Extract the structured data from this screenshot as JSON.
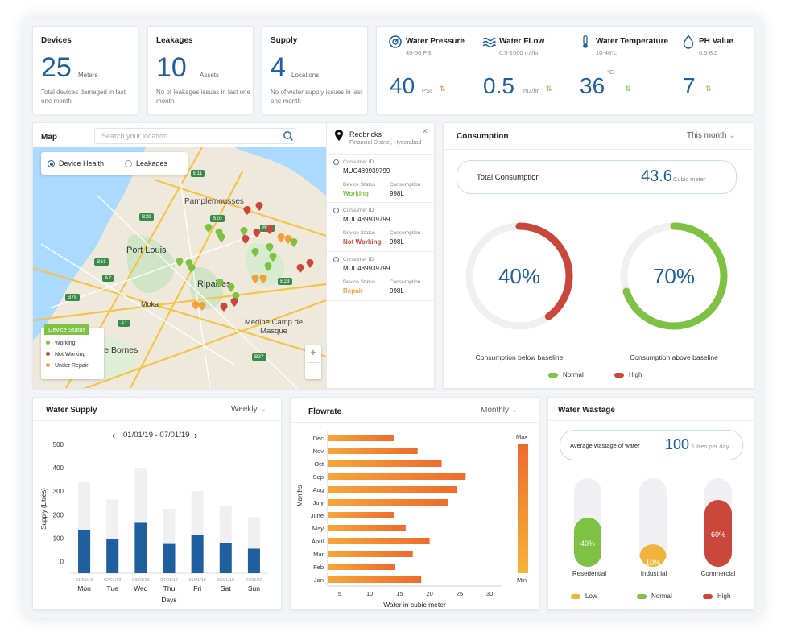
{
  "stats": [
    {
      "title": "Devices",
      "value": "25",
      "unit": "Meters",
      "desc": "Total devices damaged in last one month"
    },
    {
      "title": "Leakages",
      "value": "10",
      "unit": "Assets",
      "desc": "No of leakages issues in last one month"
    },
    {
      "title": "Supply",
      "value": "4",
      "unit": "Locations",
      "desc": "No of water supply issues in last one month"
    }
  ],
  "kpis": [
    {
      "title": "Water Pressure",
      "range": "45-50 PSI",
      "value": "40",
      "unit": "PSI",
      "icon": "gauge-icon"
    },
    {
      "title": "Water FLow",
      "range": "0.5-1000 m³/hr",
      "value": "0.5",
      "unit": "m3/hr",
      "icon": "waves-icon"
    },
    {
      "title": "Water Temperature",
      "range": "10-40°c",
      "value": "36",
      "unit": "°C",
      "icon": "thermometer-icon"
    },
    {
      "title": "PH Value",
      "range": "6.5-8.5",
      "value": "7",
      "unit": "",
      "icon": "droplet-icon"
    }
  ],
  "map": {
    "title": "Map",
    "search_placeholder": "Search your location",
    "toggle": {
      "device_health": "Device Health",
      "leakages": "Leakages"
    },
    "places": [
      "Pamplemousses",
      "Port Louis",
      "Ripailles",
      "Moka",
      "Medine Camp de Masque",
      "Quatre Bornes"
    ],
    "road_labels": [
      "B11",
      "B29",
      "B20",
      "B21",
      "B31",
      "A2",
      "B23",
      "B78",
      "A1",
      "B27"
    ],
    "legend": {
      "title": "Device Status",
      "working": "Working",
      "not_working": "Not Working",
      "under_repair": "Under Repair"
    },
    "zoom_in": "+",
    "zoom_out": "−"
  },
  "location": {
    "name": "Redbricks",
    "sub": "Financial District, Hyderabad"
  },
  "consumers": [
    {
      "id_label": "Consumer ID",
      "id": "MUC489939799",
      "status_label": "Device Status",
      "status": "Working",
      "cons_label": "Consumption",
      "cons": "998L"
    },
    {
      "id_label": "Consumer ID",
      "id": "MUC489939799",
      "status_label": "Device Status",
      "status": "Not Working",
      "cons_label": "Consumption",
      "cons": "998L"
    },
    {
      "id_label": "Consumer ID",
      "id": "MUC489939799",
      "status_label": "Device Status",
      "status": "Repair",
      "cons_label": "Consumption",
      "cons": "998L"
    }
  ],
  "consumption": {
    "title": "Consumption",
    "period": "This month",
    "total_label": "Total Consumption",
    "total_value": "43.6",
    "total_unit": "Cubic meter",
    "rings": [
      {
        "pct": 40,
        "label_text": "40%",
        "caption": "Consumption below baseline",
        "color": "#c9473b"
      },
      {
        "pct": 70,
        "label_text": "70%",
        "caption": "Consumption above baseline",
        "color": "#7dc242"
      }
    ],
    "legend": {
      "normal": "Normal",
      "high": "High"
    }
  },
  "water_supply": {
    "title": "Water Supply",
    "period": "Weekly",
    "date_range": "01/01/19 - 07/01/19"
  },
  "flowrate": {
    "title": "Flowrate",
    "period": "Monthly",
    "max_label": "Max",
    "min_label": "Min"
  },
  "wastage": {
    "title": "Water Wastage",
    "avg_label": "Average wastage of water",
    "avg_value": "100",
    "avg_unit": "Litres per day",
    "tubes": [
      {
        "label": "Resedential",
        "pct": 40,
        "pct_text": "40%",
        "color": "#7dc242"
      },
      {
        "label": "Industrial",
        "pct": 10,
        "pct_text": "10%",
        "color": "#f0b43c"
      },
      {
        "label": "Commercial",
        "pct": 60,
        "pct_text": "60%",
        "color": "#c9473b"
      }
    ],
    "legend": {
      "low": "Low",
      "normal": "Normal",
      "high": "High"
    }
  },
  "chart_data": [
    {
      "type": "bar",
      "title": "Water Supply",
      "categories": [
        "Mon",
        "Tue",
        "Wed",
        "Thu",
        "Fri",
        "Sat",
        "Sun"
      ],
      "dates": [
        "01/01/19",
        "02/01/19",
        "03/01/19",
        "04/01/19",
        "05/01/19",
        "06/01/19",
        "07/01/19"
      ],
      "series": [
        {
          "name": "",
          "values": [
            340,
            265,
            400,
            225,
            300,
            235,
            190
          ],
          "color": "#f0f0f0"
        },
        {
          "name": "",
          "values": [
            135,
            95,
            165,
            75,
            115,
            80,
            55
          ],
          "color": "#1f5f9e"
        }
      ],
      "yticks": [
        "500",
        "400",
        "300",
        "200",
        "100",
        "0"
      ],
      "ylim": [
        -50,
        500
      ],
      "xlabel": "Days",
      "ylabel": "Supply (Litres)"
    },
    {
      "type": "bar",
      "orientation": "horizontal",
      "title": "Flowrate",
      "categories": [
        "Dec",
        "Nov",
        "Oct",
        "Sep",
        "Aug",
        "July",
        "June",
        "May",
        "April",
        "Mar",
        "Feb",
        "Jan"
      ],
      "values": [
        14,
        18,
        22,
        26,
        24.5,
        23,
        14,
        16,
        20,
        17.2,
        14.2,
        18.6
      ],
      "xticks": [
        "5",
        "10",
        "15",
        "20",
        "25",
        "30"
      ],
      "xlim": [
        3,
        32
      ],
      "xlabel": "Water in cubic meter",
      "ylabel": "Months"
    }
  ]
}
